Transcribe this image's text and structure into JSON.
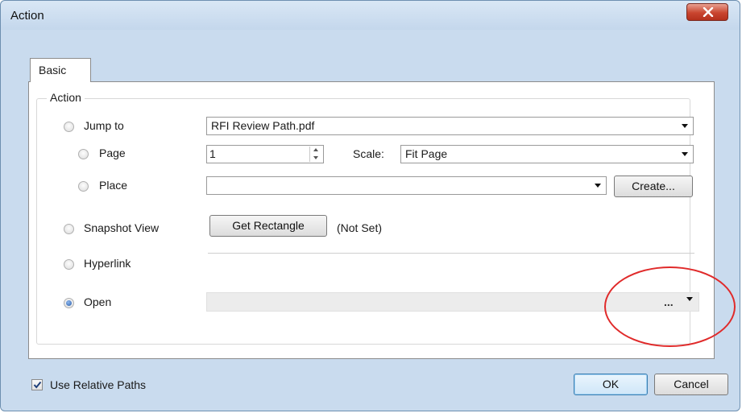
{
  "window": {
    "title": "Action"
  },
  "tabs": [
    {
      "label": "Basic"
    }
  ],
  "group": {
    "label": "Action"
  },
  "options": {
    "jump_to": {
      "label": "Jump to",
      "file": "RFI Review Path.pdf"
    },
    "page": {
      "label": "Page",
      "value": "1",
      "scale_label": "Scale:",
      "scale_value": "Fit Page"
    },
    "place": {
      "label": "Place",
      "value": "",
      "create_button": "Create..."
    },
    "snapshot_view": {
      "label": "Snapshot View",
      "button": "Get Rectangle",
      "status": "(Not Set)"
    },
    "hyperlink": {
      "label": "Hyperlink",
      "value": ""
    },
    "open": {
      "label": "Open",
      "value": "",
      "browse": "...",
      "selected": true
    }
  },
  "footer": {
    "use_relative_paths": {
      "label": "Use Relative Paths",
      "checked": true
    },
    "ok": "OK",
    "cancel": "Cancel"
  },
  "colors": {
    "annotation_circle": "#e02a2a",
    "close_button": "#c9452f"
  }
}
